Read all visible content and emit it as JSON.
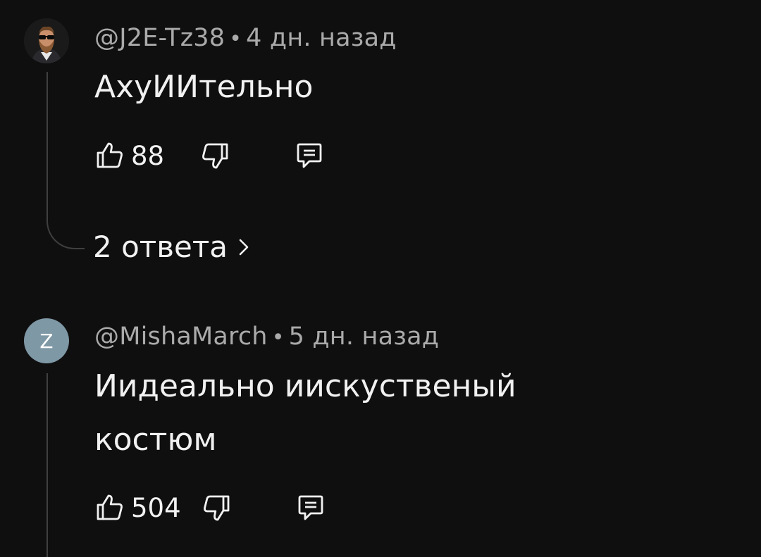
{
  "comments": [
    {
      "author": "@J2E-Tz38",
      "separator": "•",
      "time": "4 дн. назад",
      "text": "АхуИИтельно",
      "likes": "88",
      "replies_label": "2 ответа",
      "avatar_type": "photo"
    },
    {
      "author": "@MishaMarch",
      "separator": "•",
      "time": "5 дн. назад",
      "text": "Иидеально иискуственый костюм",
      "likes": "504",
      "avatar_letter": "Z",
      "avatar_color": "#7f98a6"
    }
  ],
  "icons": {
    "like": "thumb-up-icon",
    "dislike": "thumb-down-icon",
    "reply": "comment-icon",
    "expand": "chevron-right-icon"
  }
}
